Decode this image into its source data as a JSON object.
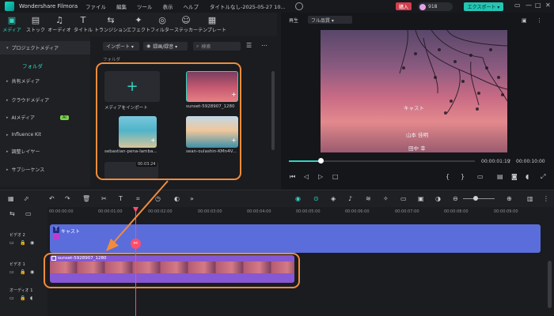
{
  "titlebar": {
    "app_name": "Wondershare Filmora",
    "menu": [
      "ファイル",
      "編集",
      "ツール",
      "表示",
      "ヘルプ"
    ],
    "doc_title": "タイトルなし-2025-05-27 10...",
    "buy_label": "購入",
    "coin_count": "918",
    "export_label": "エクスポート ▾"
  },
  "media_tabs": [
    {
      "label": "メディア",
      "icon": "media-icon",
      "glyph": "▣"
    },
    {
      "label": "ストック",
      "icon": "stock-icon",
      "glyph": "▤"
    },
    {
      "label": "オーディオ",
      "icon": "audio-icon",
      "glyph": "♫"
    },
    {
      "label": "タイトル",
      "icon": "title-icon",
      "glyph": "T"
    },
    {
      "label": "トランジション",
      "icon": "transition-icon",
      "glyph": "⇆"
    },
    {
      "label": "エフェクト",
      "icon": "effect-icon",
      "glyph": "✦"
    },
    {
      "label": "フィルター",
      "icon": "filter-icon",
      "glyph": "◎"
    },
    {
      "label": "ステッカー",
      "icon": "sticker-icon",
      "glyph": "☺"
    },
    {
      "label": "テンプレート",
      "icon": "template-icon",
      "glyph": "▦"
    }
  ],
  "sidebar": {
    "items": [
      "プロジェクトメディア",
      "共有メディア",
      "クラウドメディア",
      "AIメディア",
      "Influence Kit",
      "調整レイヤー",
      "サブシーケンス"
    ],
    "folder": "フォルダ",
    "ai_badge": "AI"
  },
  "media": {
    "import_label": "インポート ▾",
    "record_label": "録画/録音 ▾",
    "search_placeholder": "検索",
    "folder_label": "フォルダ",
    "tiles": {
      "import": "メディアをインポート",
      "sunset": "sunset-5928907_1280",
      "beach": "sebastian-pena-lamba...",
      "ocean": "sean-oulashin-KMn4V..."
    },
    "title_clip_duration": "00:03:24"
  },
  "player": {
    "label": "再生",
    "quality": "フル品質 ▾",
    "overlay": [
      "キャスト",
      "山本 佳明",
      "田中 幸"
    ],
    "time_current": "00:00:01:19",
    "time_total": "00:00:10:00"
  },
  "timeline": {
    "ruler": [
      "00:00:00:00",
      "00:00:01:00",
      "00:00:02:00",
      "00:00:03:00",
      "00:00:04:00",
      "00:00:05:00",
      "00:00:06:00",
      "00:00:07:00",
      "00:00:08:00",
      "00:00:09:00"
    ],
    "tracks": [
      "ビデオ 2",
      "ビデオ 1",
      "オーディオ 1"
    ],
    "title_clip": "キャスト",
    "video_clip": "sunset-5928907_1280"
  },
  "accent_color": "#31d4c1",
  "highlight_color": "#f28c3c",
  "playhead_color": "#ff4d6d"
}
